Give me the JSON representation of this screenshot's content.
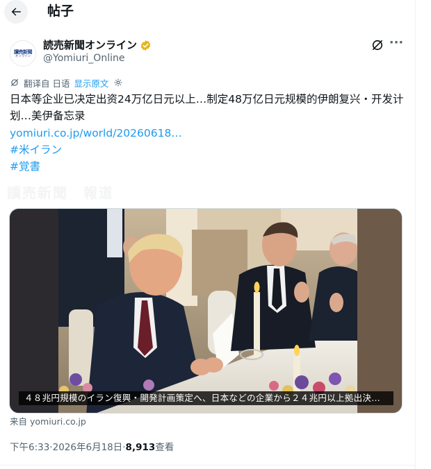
{
  "header": {
    "title": "帖子"
  },
  "author": {
    "logo_line1": "讀売新聞",
    "logo_line2": "オンライン",
    "name": "読売新聞オンライン",
    "handle": "@Yomiuri_Online"
  },
  "translation": {
    "label": "翻译自 日语",
    "show_original": "显示原文"
  },
  "tweet": {
    "text": "日本等企业已决定出资24万亿日元以上…制定48万亿日元规模的伊朗复兴・开发计划…美伊备忘录",
    "link": "yomiuri.co.jp/world/20260618…",
    "hashtags": [
      "#米イラン",
      "#覚書"
    ],
    "ghost_text": "讀売新聞　報道"
  },
  "media": {
    "caption": "４８兆円規模のイラン復興・開発計画策定へ、日本などの企業から２４兆円以上拠出決…"
  },
  "source": "来自 yomiuri.co.jp",
  "meta": {
    "time": "下午6:33",
    "separator": " · ",
    "date": "2026年6月18日",
    "views_count": "8,913",
    "views_label": " 查看"
  },
  "colors": {
    "accent": "#1d9bf0",
    "secondary_text": "#536471",
    "verified_gold": "#e2b719"
  },
  "icons": {
    "back": "arrow-left-icon",
    "verified": "verified-gold-badge-icon",
    "grok": "grok-icon",
    "more": "more-dots-icon",
    "translate": "grok-small-icon",
    "settings": "gear-icon"
  }
}
